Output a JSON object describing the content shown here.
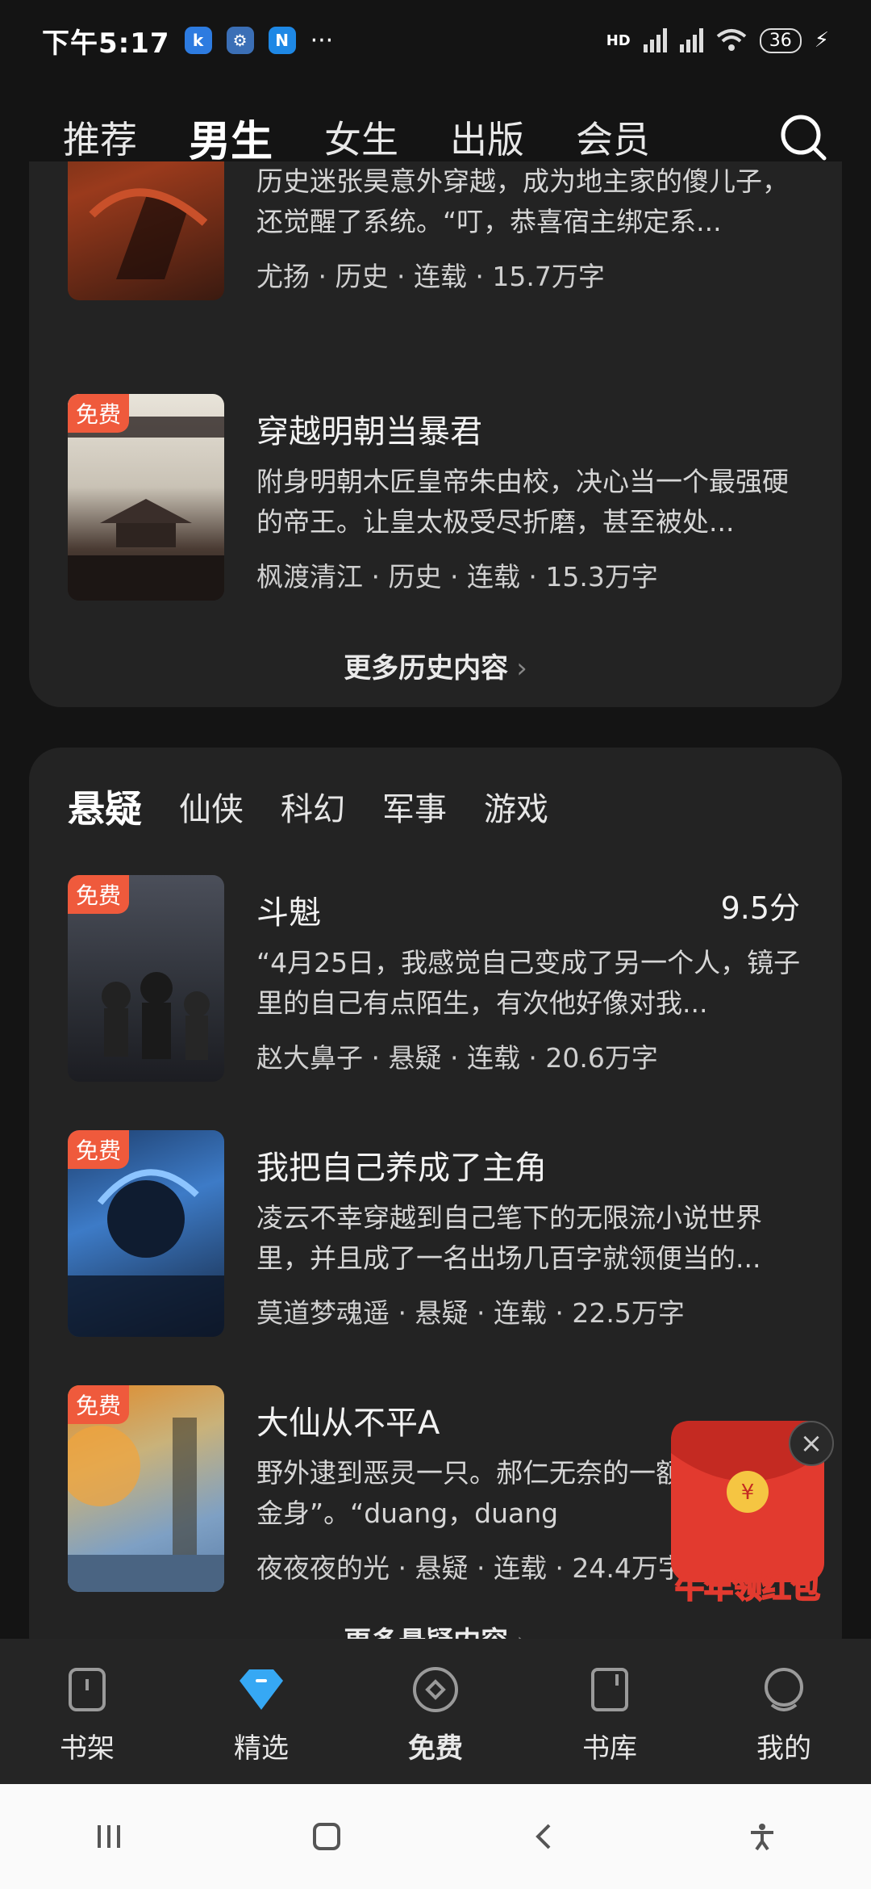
{
  "status_bar": {
    "time": "下午5:17",
    "more": "···",
    "network": "HD",
    "battery": "36"
  },
  "top_nav": {
    "tabs": [
      "推荐",
      "男生",
      "女生",
      "出版",
      "会员"
    ],
    "active_index": 1
  },
  "section_history": {
    "books": [
      {
        "title": "",
        "desc": "历史迷张昊意外穿越，成为地主家的傻儿子，还觉醒了系统。“叮，恭喜宿主绑定系...",
        "meta": "尤扬 · 历史 · 连载 · 15.7万字",
        "free": false
      },
      {
        "title": "穿越明朝当暴君",
        "desc": "附身明朝木匠皇帝朱由校，决心当一个最强硬的帝王。让皇太极受尽折磨，甚至被处...",
        "meta": "枫渡清江 · 历史 · 连载 · 15.3万字",
        "free_label": "免费"
      }
    ],
    "more_label": "更多历史内容"
  },
  "section_mystery": {
    "genre_tabs": [
      "悬疑",
      "仙侠",
      "科幻",
      "军事",
      "游戏"
    ],
    "active_index": 0,
    "books": [
      {
        "title": "斗魁",
        "score": "9.5分",
        "desc": "“4月25日，我感觉自己变成了另一个人，镜子里的自己有点陌生，有次他好像对我...",
        "meta": "赵大鼻子 · 悬疑 · 连载 · 20.6万字",
        "free_label": "免费"
      },
      {
        "title": "我把自己养成了主角",
        "desc": "凌云不幸穿越到自己笔下的无限流小说世界里，并且成了一名出场几百字就领便当的...",
        "meta": "莫道梦魂遥 · 悬疑 · 连载 · 22.5万字",
        "free_label": "免费"
      },
      {
        "title": "大仙从不平A",
        "desc": "野外逮到恶灵一只。郝仁无奈的一额头，“丈二金身”。“duang，duang",
        "meta": "夜夜夜的光 · 悬疑 · 连载 · 24.4万字",
        "free_label": "免费"
      }
    ],
    "more_label": "更多悬疑内容"
  },
  "promo": {
    "label": "牛年领红包"
  },
  "bottom_nav": {
    "items": [
      "书架",
      "精选",
      "免费",
      "书库",
      "我的"
    ],
    "active_index": 1
  },
  "colors": {
    "accent": "#2f9bf0",
    "free_badge": "#ef5a3c",
    "card_bg": "#232323",
    "page_bg": "#141414"
  }
}
